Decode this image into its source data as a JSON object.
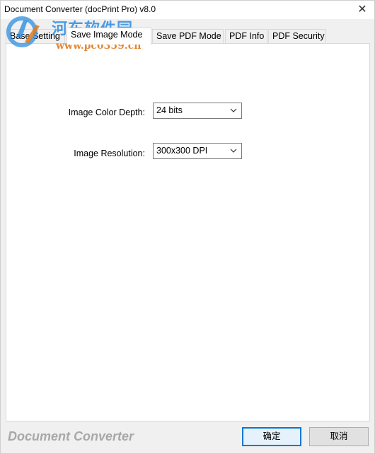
{
  "window": {
    "title": "Document Converter (docPrint Pro) v8.0",
    "close_glyph": "✕"
  },
  "watermark": {
    "cn_text": "河东软件园",
    "url_text": "www.pc0359.cn"
  },
  "tabs": [
    {
      "label": "Base Setting",
      "active": false
    },
    {
      "label": "Save Image Mode",
      "active": true
    },
    {
      "label": "Save PDF Mode",
      "active": false
    },
    {
      "label": "PDF Info",
      "active": false
    },
    {
      "label": "PDF Security",
      "active": false
    }
  ],
  "form": {
    "color_depth_label": "Image Color Depth:",
    "color_depth_value": "24 bits",
    "resolution_label": "Image Resolution:",
    "resolution_value": "300x300 DPI"
  },
  "footer": {
    "brand": "Document Converter",
    "ok_label": "确定",
    "cancel_label": "取消"
  },
  "colors": {
    "accent": "#0078d7",
    "watermark_blue": "#2e8de0",
    "watermark_orange": "#e07a1f"
  }
}
